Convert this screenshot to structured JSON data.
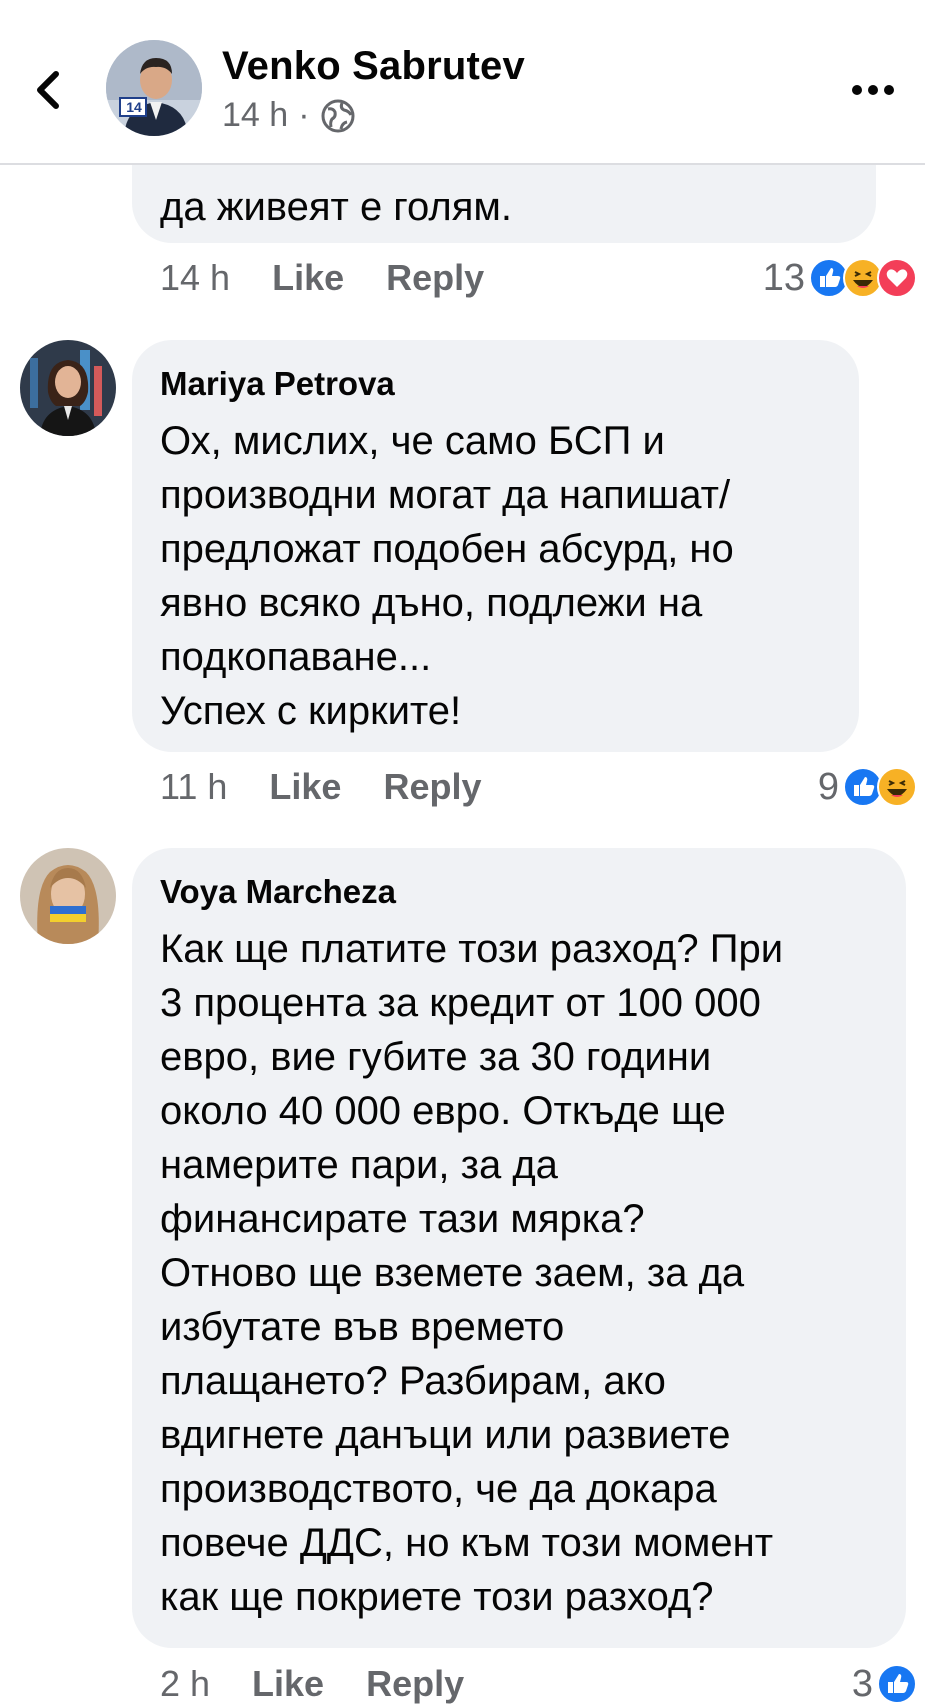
{
  "header": {
    "author_name": "Venko Sabrutev",
    "time": "14 h",
    "separator": "·",
    "avatar_badge": "14"
  },
  "first_comment": {
    "partial_text": "да живеят е голям.",
    "time": "14 h",
    "like_label": "Like",
    "reply_label": "Reply",
    "reaction_count": "13",
    "reactions": [
      "like-icon",
      "haha-icon",
      "love-icon"
    ]
  },
  "comments": [
    {
      "name": "Mariya Petrova",
      "text": "Ох, мислих, че само БСП и\nпроизводни могат да напишат/\nпредложат подобен абсурд, но\nявно всяко дъно, подлежи на\nподкопаване...\nУспех с кирките!",
      "time": "11 h",
      "like_label": "Like",
      "reply_label": "Reply",
      "reaction_count": "9",
      "reactions": [
        "like-icon",
        "haha-icon"
      ]
    },
    {
      "name": "Voya Marcheza",
      "text": "Как ще платите този разход? При\n3 процента за кредит от 100 000\nевро, вие губите за 30 години\nоколо 40 000 евро. Откъде ще\nнамерите пари, за да\nфинансирате тази мярка?\nОтново ще вземете заем, за да\nизбутате във времето\nплащането? Разбирам, ако\nвдигнете данъци или развиете\nпроизводството, че да докара\nповече ДДС, но към този момент\nкак ще покриете този разход?",
      "time": "2 h",
      "like_label": "Like",
      "reply_label": "Reply",
      "reaction_count": "3",
      "reactions": [
        "like-icon"
      ]
    }
  ],
  "colors": {
    "like_blue": "#1877f2",
    "haha_yellow": "#f7b125",
    "love_red": "#f33e58",
    "bubble_bg": "#f0f2f5",
    "meta_gray": "#65676b"
  }
}
